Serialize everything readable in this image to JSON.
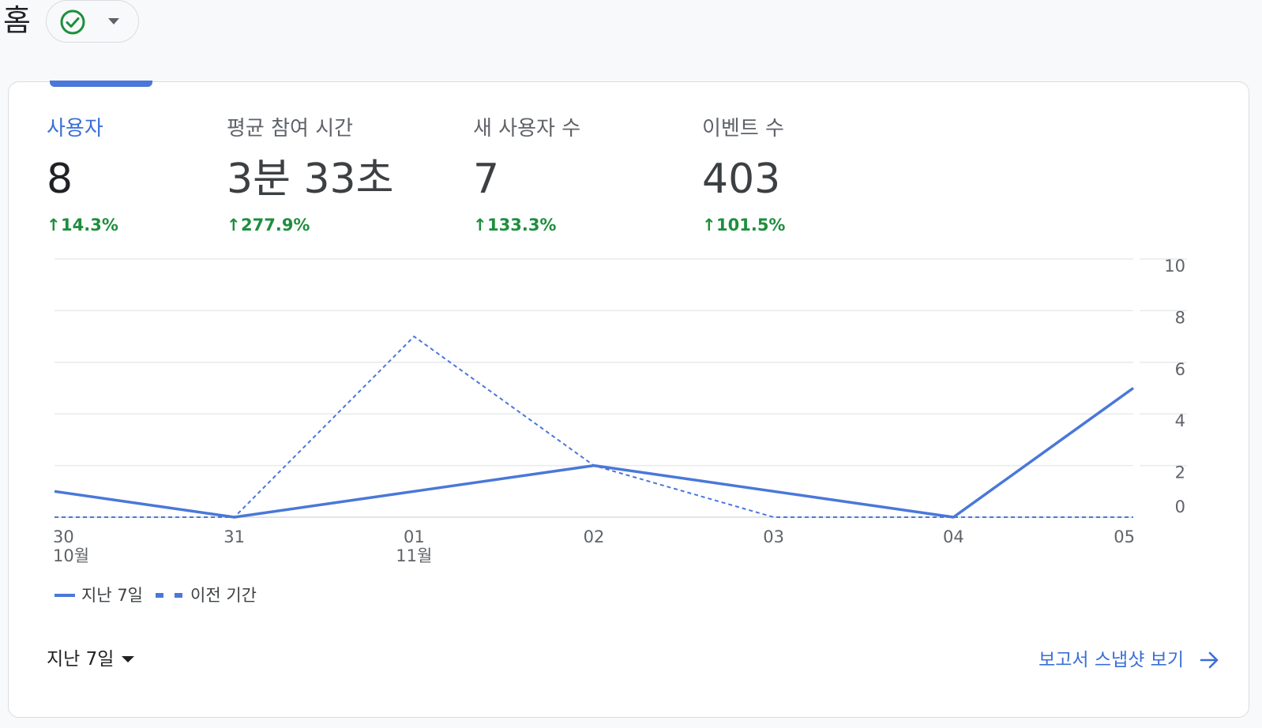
{
  "header": {
    "title": "홈",
    "status_icon": "check-circle-icon",
    "caret_icon": "caret-down-icon"
  },
  "metrics": [
    {
      "label": "사용자",
      "value": "8",
      "change": "14.3%",
      "active": true
    },
    {
      "label": "평균 참여 시간",
      "value": "3분 33초",
      "change": "277.9%",
      "active": false
    },
    {
      "label": "새 사용자 수",
      "value": "7",
      "change": "133.3%",
      "active": false
    },
    {
      "label": "이벤트 수",
      "value": "403",
      "change": "101.5%",
      "active": false
    }
  ],
  "chart_data": {
    "type": "line",
    "x": [
      "30",
      "31",
      "01",
      "02",
      "03",
      "04",
      "05"
    ],
    "x_sublabels": [
      "10월",
      "",
      "11월",
      "",
      "",
      "",
      ""
    ],
    "series": [
      {
        "name": "지난 7일",
        "style": "solid",
        "values": [
          1,
          0,
          1,
          2,
          1,
          0,
          5
        ]
      },
      {
        "name": "이전 기간",
        "style": "dashed",
        "values": [
          0,
          0,
          7,
          2,
          0,
          0,
          0
        ]
      }
    ],
    "yticks": [
      0,
      2,
      4,
      6,
      8,
      10
    ],
    "ylim": [
      0,
      10
    ],
    "y_axis_side": "right",
    "grid": true,
    "legend_position": "bottom-left"
  },
  "legend": {
    "current_label": "지난 7일",
    "previous_label": "이전 기간"
  },
  "footer": {
    "range_label": "지난 7일",
    "report_link_label": "보고서 스냅샷 보기"
  },
  "colors": {
    "accent": "#4a77d9",
    "positive": "#1e8e3e",
    "link": "#3a6fd8"
  }
}
